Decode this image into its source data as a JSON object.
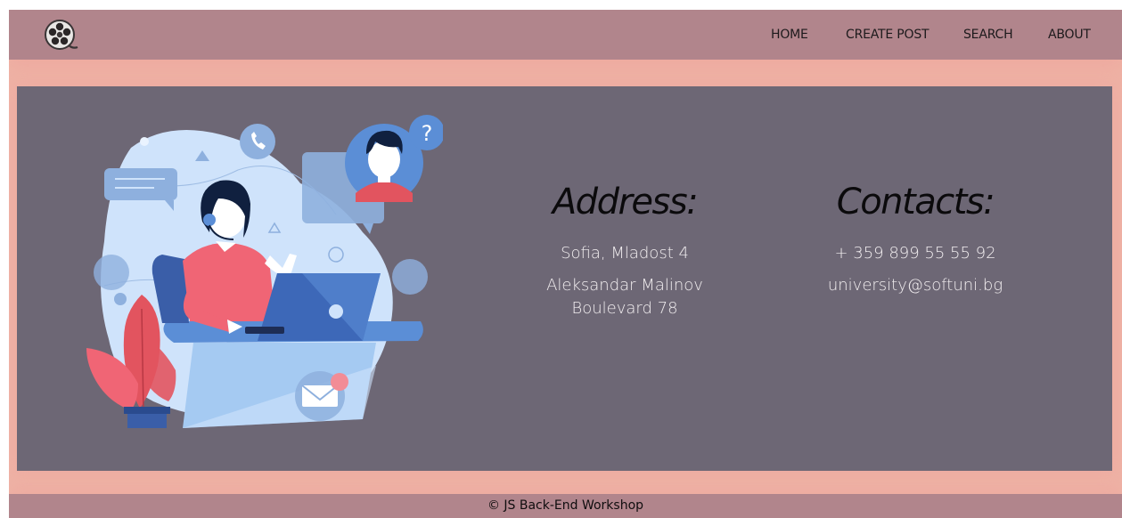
{
  "nav": {
    "home": "HOME",
    "create_post": "CREATE POST",
    "search": "SEARCH",
    "about": "ABOUT"
  },
  "address": {
    "heading": "Address:",
    "line1": "Sofia, Mladost 4",
    "line2": "Aleksandar Malinov",
    "line3": "Boulevard 78"
  },
  "contacts": {
    "heading": "Contacts:",
    "phone": "+ 359 899 55 55 92",
    "email": "university@softuni.bg"
  },
  "footer": {
    "text": "© JS Back-End Workshop"
  },
  "colors": {
    "nav_bg": "#b1858c",
    "page_bg": "#efb4a6",
    "card_bg": "#6d6775",
    "text_light": "#f2eef0"
  },
  "icons": {
    "logo": "film-reel-icon",
    "illustration": "support-agent-illustration"
  }
}
